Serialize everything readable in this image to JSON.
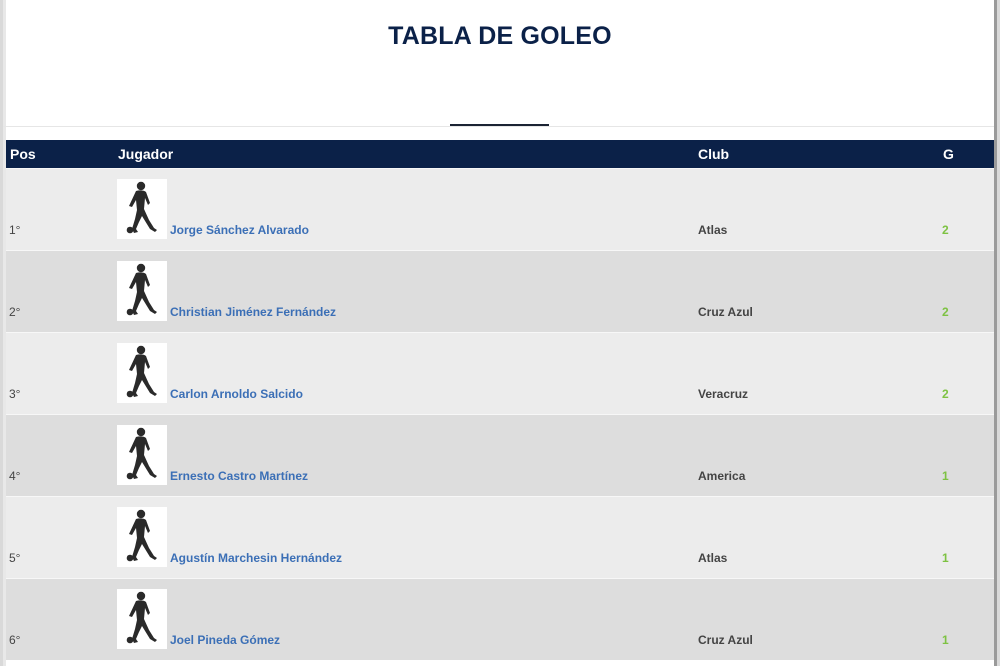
{
  "title": "TABLA DE GOLEO",
  "table": {
    "headers": {
      "pos": "Pos",
      "player": "Jugador",
      "club": "Club",
      "goals": "G"
    },
    "rows": [
      {
        "pos": "1°",
        "player": "Jorge Sánchez Alvarado",
        "club": "Atlas",
        "goals": "2"
      },
      {
        "pos": "2°",
        "player": "Christian Jiménez Fernández",
        "club": "Cruz Azul",
        "goals": "2"
      },
      {
        "pos": "3°",
        "player": "Carlon Arnoldo Salcido",
        "club": "Veracruz",
        "goals": "2"
      },
      {
        "pos": "4°",
        "player": "Ernesto Castro Martínez",
        "club": "America",
        "goals": "1"
      },
      {
        "pos": "5°",
        "player": "Agustín Marchesin Hernández",
        "club": "Atlas",
        "goals": "1"
      },
      {
        "pos": "6°",
        "player": "Joel Pineda Gómez",
        "club": "Cruz Azul",
        "goals": "1"
      }
    ]
  },
  "icons": {
    "player_avatar": "soccer-player-silhouette-icon"
  },
  "colors": {
    "header_bg": "#0b2148",
    "title": "#0b2148",
    "player_link": "#3b6fb6",
    "goals": "#7dc242"
  }
}
